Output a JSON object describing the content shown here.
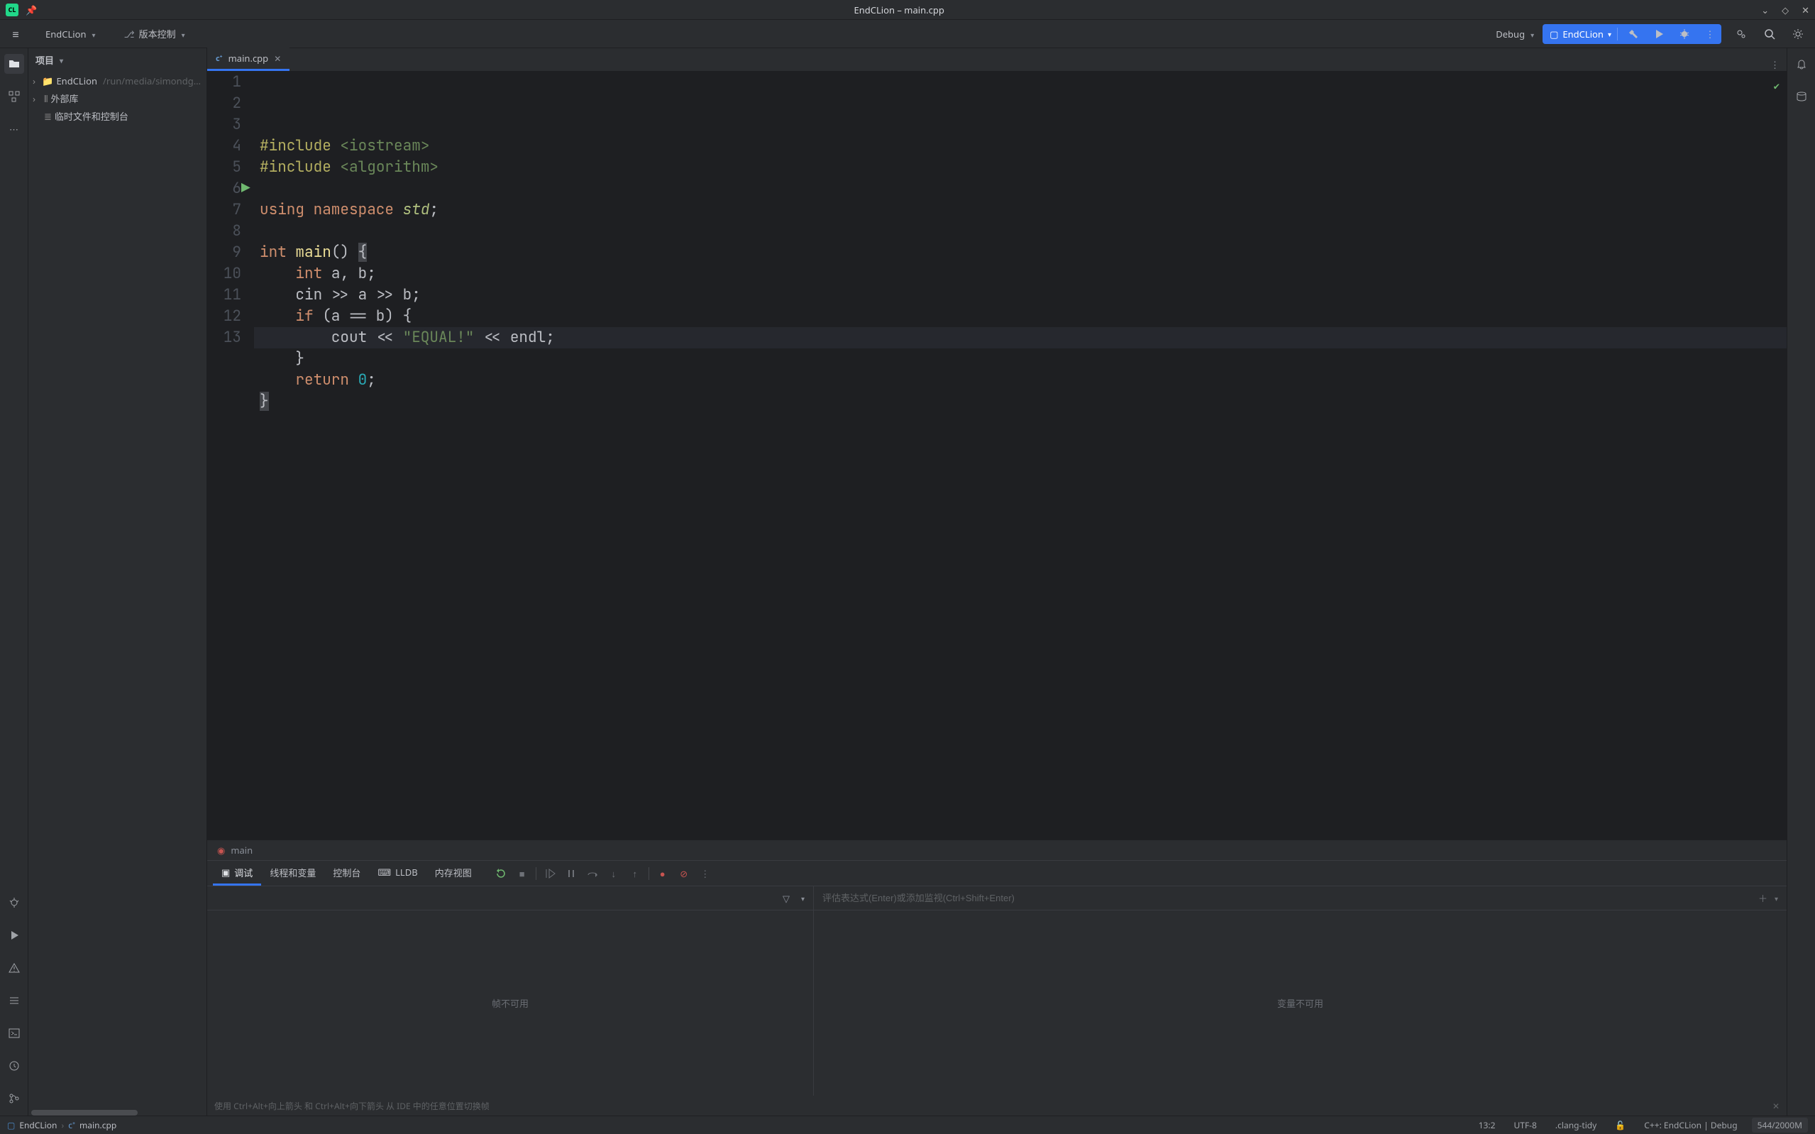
{
  "titlebar": {
    "title": "EndCLion – main.cpp"
  },
  "toolbar": {
    "project": "EndCLion",
    "vcs": "版本控制",
    "config": "Debug",
    "run_target": "EndCLion"
  },
  "projectPanel": {
    "header": "项目",
    "nodes": [
      {
        "chev": "›",
        "icon": "folder",
        "label": "EndCLion",
        "path": "/run/media/simondguqiu/Dat"
      },
      {
        "chev": "›",
        "icon": "lib",
        "label": "外部库",
        "path": ""
      },
      {
        "chev": "",
        "icon": "scratch",
        "label": "临时文件和控制台",
        "path": ""
      }
    ]
  },
  "tabs": [
    {
      "icon": "cpp",
      "label": "main.cpp",
      "active": true
    }
  ],
  "code": {
    "runnable_line": 6,
    "cursor_line": 13,
    "lines": [
      [
        {
          "c": "pp",
          "t": "#include"
        },
        {
          "c": "",
          "t": " "
        },
        {
          "c": "inc",
          "t": "<iostream>"
        }
      ],
      [
        {
          "c": "pp",
          "t": "#include"
        },
        {
          "c": "",
          "t": " "
        },
        {
          "c": "inc",
          "t": "<algorithm>"
        }
      ],
      [],
      [
        {
          "c": "kw",
          "t": "using"
        },
        {
          "c": "",
          "t": " "
        },
        {
          "c": "kw",
          "t": "namespace"
        },
        {
          "c": "",
          "t": " "
        },
        {
          "c": "ns",
          "t": "std"
        },
        {
          "c": "",
          "t": ";"
        }
      ],
      [],
      [
        {
          "c": "kw",
          "t": "int"
        },
        {
          "c": "",
          "t": " "
        },
        {
          "c": "fn",
          "t": "main"
        },
        {
          "c": "",
          "t": "() "
        },
        {
          "c": "brace-hl",
          "t": "{"
        }
      ],
      [
        {
          "c": "",
          "t": "    "
        },
        {
          "c": "kw",
          "t": "int"
        },
        {
          "c": "",
          "t": " a, b;"
        }
      ],
      [
        {
          "c": "",
          "t": "    cin >> a >> b;"
        }
      ],
      [
        {
          "c": "",
          "t": "    "
        },
        {
          "c": "kw",
          "t": "if"
        },
        {
          "c": "",
          "t": " (a == b) {"
        }
      ],
      [
        {
          "c": "",
          "t": "        cout << "
        },
        {
          "c": "str",
          "t": "\"EQUAL!\""
        },
        {
          "c": "",
          "t": " << endl;"
        }
      ],
      [
        {
          "c": "",
          "t": "    }"
        }
      ],
      [
        {
          "c": "",
          "t": "    "
        },
        {
          "c": "kw",
          "t": "return"
        },
        {
          "c": "",
          "t": " "
        },
        {
          "c": "num",
          "t": "0"
        },
        {
          "c": "",
          "t": ";"
        }
      ],
      [
        {
          "c": "brace-hl",
          "t": "}"
        }
      ]
    ]
  },
  "breadcrumb": {
    "icon": "!",
    "label": "main"
  },
  "debug": {
    "tabs": [
      {
        "label": "调试",
        "active": true,
        "icon": "layout"
      },
      {
        "label": "线程和变量",
        "active": false
      },
      {
        "label": "控制台",
        "active": false
      },
      {
        "label": "LLDB",
        "active": false,
        "icon": "term"
      },
      {
        "label": "内存视图",
        "active": false
      }
    ],
    "frames_empty": "帧不可用",
    "vars_empty": "变量不可用",
    "vars_placeholder": "评估表达式(Enter)或添加监视(Ctrl+Shift+Enter)",
    "hint": "使用 Ctrl+Alt+向上箭头 和 Ctrl+Alt+向下箭头 从 IDE 中的任意位置切换帧"
  },
  "status": {
    "crumb1": "EndCLion",
    "crumb2": "main.cpp",
    "pos": "13:2",
    "enc": "UTF-8",
    "tidy": ".clang-tidy",
    "cmake": "C++: EndCLion | Debug",
    "mem": "544/2000M"
  }
}
